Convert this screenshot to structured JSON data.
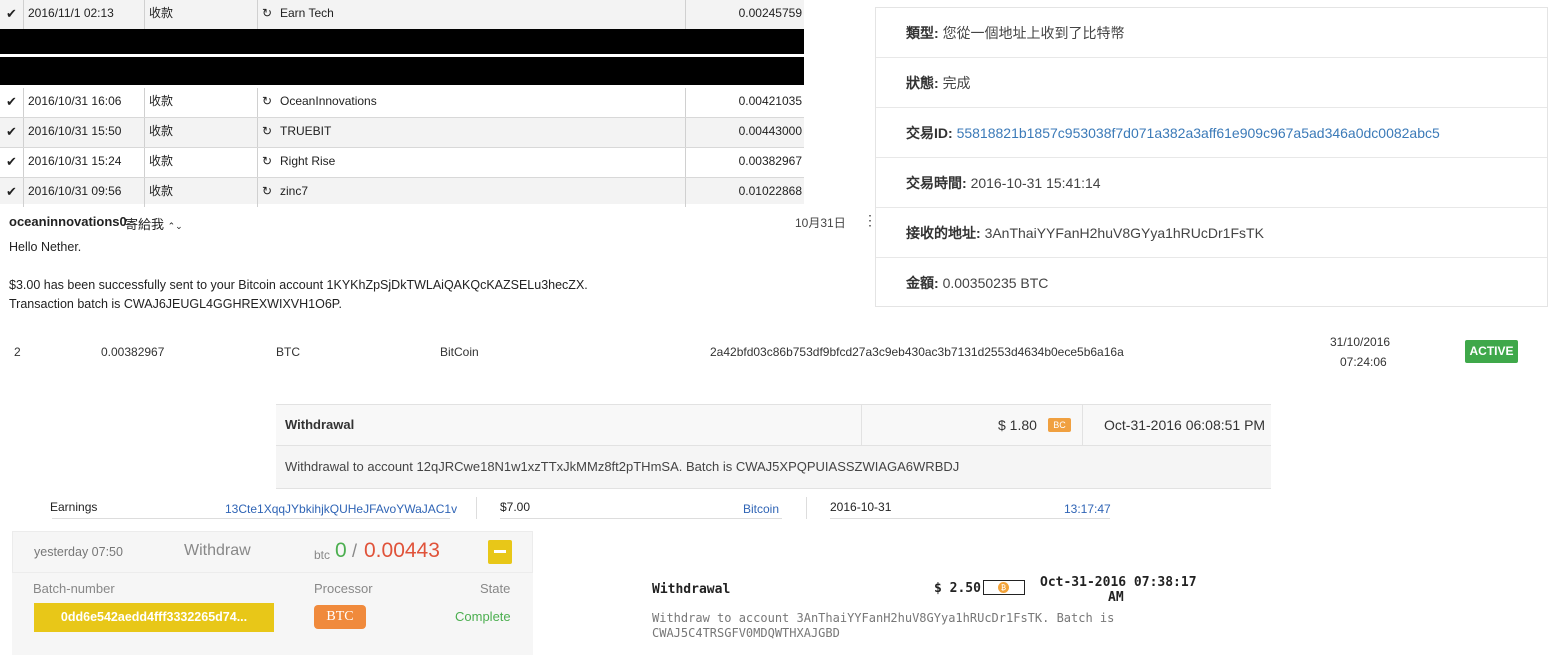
{
  "transactions": {
    "rows": [
      {
        "date": "2016/11/1 02:13",
        "type": "收款",
        "name": "Earn Tech",
        "amount": "0.00245759"
      },
      {
        "date": "2016/10/31 16:06",
        "type": "收款",
        "name": "OceanInnovations",
        "amount": "0.00421035"
      },
      {
        "date": "2016/10/31 15:50",
        "type": "收款",
        "name": "TRUEBIT",
        "amount": "0.00443000"
      },
      {
        "date": "2016/10/31 15:24",
        "type": "收款",
        "name": "Right Rise",
        "amount": "0.00382967"
      },
      {
        "date": "2016/10/31 09:56",
        "type": "收款",
        "name": "zinc7",
        "amount": "0.01022868"
      }
    ],
    "check_glyph": "✔",
    "return_glyph": "↻"
  },
  "details": {
    "type_label": "類型:",
    "type_value": "您從一個地址上收到了比特幣",
    "status_label": "狀態:",
    "status_value": "完成",
    "txid_label": "交易ID:",
    "txid_value": "55818821b1857c953038f7d071a382a3aff61e909c967a5ad346a0dc0082abc5",
    "time_label": "交易時間:",
    "time_value": "2016-10-31 15:41:14",
    "address_label": "接收的地址:",
    "address_value": "3AnThaiYYFanH2huV8GYya1hRUcDr1FsTK",
    "amount_label": "金額:",
    "amount_value": "0.00350235 BTC"
  },
  "email": {
    "sender": "oceaninnovations0",
    "sender_tail": "寄給我",
    "date": "10月31日",
    "greeting": "Hello Nether.",
    "line1": "$3.00 has been successfully sent to your Bitcoin account 1KYKhZpSjDkTWLAiQAKQcKAZSELu3hecZX.",
    "line2": "Transaction batch is CWAJ6JEUGL4GGHREXWIXVH1O6P."
  },
  "deposit": {
    "index": "2",
    "amount": "0.00382967",
    "currency": "BTC",
    "method": "BitCoin",
    "hash": "2a42bfd03c86b753df9bfcd27a3c9eb430ac3b7131d2553d4634b0ece5b6a16a",
    "date": "31/10/2016",
    "time": "07:24:06",
    "status": "ACTIVE"
  },
  "withdrawal1": {
    "title": "Withdrawal",
    "amount": "$ 1.80",
    "badge": "BC",
    "datetime": "Oct-31-2016 06:08:51 PM",
    "description": "Withdrawal to account 12qJRCwe18N1w1xzTTxJkMMz8ft2pTHmSA. Batch is CWAJ5XPQPUIASSZWIAGA6WRBDJ"
  },
  "earnings": {
    "label": "Earnings",
    "address": "13Cte1XqqJYbkihjkQUHeJFAvoYWaJAC1v",
    "amount": "$7.00",
    "method": "Bitcoin",
    "date": "2016-10-31",
    "time": "13:17:47"
  },
  "withdraw_widget": {
    "when": "yesterday 07:50",
    "action": "Withdraw",
    "unit": "btc",
    "zero": "0",
    "slash": "/",
    "amount": "0.00443",
    "batch_header": "Batch-number",
    "processor_header": "Processor",
    "state_header": "State",
    "batch_value": "0dd6e542aedd4fff3332265d74...",
    "processor_value": "BTC",
    "state_value": "Complete",
    "colors": {
      "accent": "#e8c718",
      "green": "#4caf50",
      "red": "#e0533a",
      "orange": "#f08a3c"
    }
  },
  "withdrawal3": {
    "title": "Withdrawal",
    "amount": "$ 2.50",
    "datetime_line1": "Oct-31-2016 07:38:17",
    "datetime_line2": "AM",
    "description_line1": "Withdraw to account 3AnThaiYYFanH2huV8GYya1hRUcDr1FsTK. Batch is",
    "description_line2": "CWAJ5C4TRSGFV0MDQWTHXAJGBD"
  }
}
